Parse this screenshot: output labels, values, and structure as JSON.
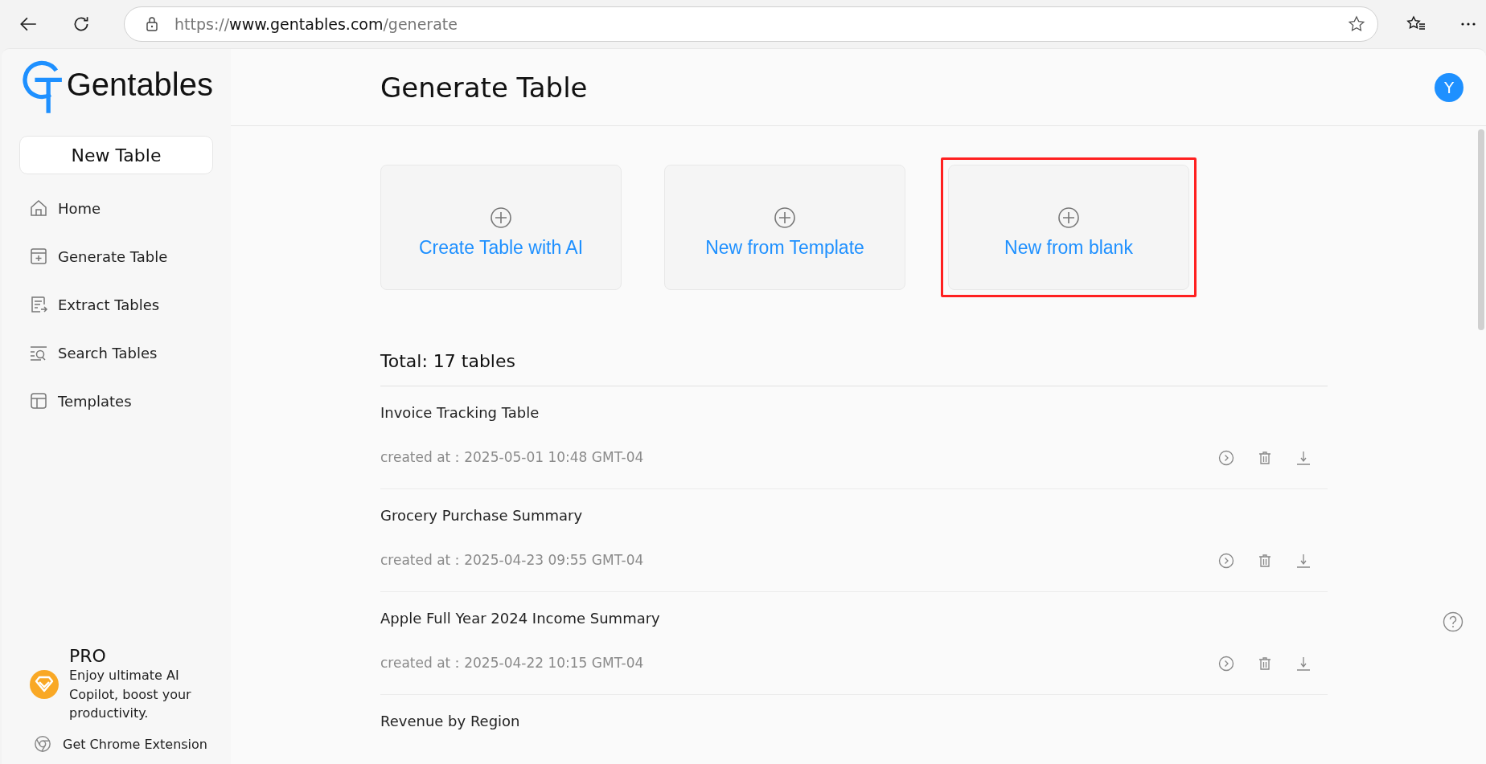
{
  "browser": {
    "url": {
      "scheme": "https://",
      "host": "www.gentables.com",
      "path": "/generate"
    }
  },
  "sidebar": {
    "brand": "Gentables",
    "new_button": "New Table",
    "items": [
      {
        "label": "Home"
      },
      {
        "label": "Generate Table"
      },
      {
        "label": "Extract Tables"
      },
      {
        "label": "Search Tables"
      },
      {
        "label": "Templates"
      }
    ],
    "promo": {
      "title": "PRO",
      "text": "Enjoy ultimate AI Copilot, boost your productivity."
    },
    "extension_link": "Get Chrome Extension"
  },
  "header": {
    "title": "Generate Table",
    "avatar": "Y"
  },
  "create_options": [
    {
      "label": "Create Table with AI",
      "highlighted": false
    },
    {
      "label": "New from Template",
      "highlighted": false
    },
    {
      "label": "New from blank",
      "highlighted": true
    }
  ],
  "total": "Total: 17 tables",
  "tables": [
    {
      "name": "Invoice Tracking Table",
      "created": "created at：2025-05-01 10:48 GMT-04"
    },
    {
      "name": "Grocery Purchase Summary",
      "created": "created at：2025-04-23 09:55 GMT-04"
    },
    {
      "name": "Apple Full Year 2024 Income Summary",
      "created": "created at：2025-04-22 10:15 GMT-04"
    },
    {
      "name": "Revenue by Region"
    }
  ]
}
